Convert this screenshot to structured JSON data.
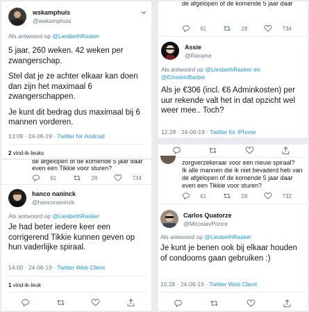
{
  "panel1": {
    "name": "wskamphuis",
    "handle": "@wskamphuis",
    "reply_prefix": "Als antwoord op",
    "reply_to": "@LiesbethRasker",
    "para1": "5 jaar, 260 weken. 42 weken per zwangerschap.",
    "para2": "Stel dat je ze achter elkaar kan doen dan zijn het maximaal 6 zwangerschappen.",
    "para3": "Je kunt dit bedrag dus maximaal bij 6 mannen vorderen.",
    "time": "13:09 · 24-06-19 ·",
    "client": "Twitter for Android",
    "likes_count": "2",
    "likes_label": "vind-ik-leuks"
  },
  "panel2": {
    "quote_fragment": "de afgelopen of de komende 5 jaar daar",
    "stats": {
      "replies": "61",
      "retweets": "28",
      "likes": "734"
    },
    "name": "Assie",
    "handle": "@Rarame",
    "reply_prefix": "Als antwoord op",
    "reply_to": "@LiesbethRasker en @EinsteinBarbie",
    "text": "Als je €306 (incl. €6 Adminkosten) per uur rekende valt het in dat opzicht wel weer mee.. Toch?",
    "time": "12:28 · 24-06-19 ·",
    "client": "Twitter for iPhone"
  },
  "panel3": {
    "quote_fragment_1": "de afgelopen of de komende 5 jaar daar",
    "quote_fragment_2": "even een Tikkie voor sturen?",
    "stats": {
      "replies": "61",
      "retweets": "28",
      "likes": "734"
    },
    "name": "hanco naninck",
    "handle": "@hanconaninck",
    "reply_prefix": "Als antwoord op",
    "reply_to": "@LiesbethRasker",
    "text": "Je had beter iedere keer een corrigerend Tikkie kunnen geven op hun vaderlijke spiraal.",
    "time": "14:00 · 24-06-19 ·",
    "client": "Twitter Web Client",
    "likes_count": "1",
    "likes_label": "vind-ik-leuk"
  },
  "panel4": {
    "quote_line_1": "zorgverzekeraar voor een nieuw spiraal?",
    "quote_line_2": "Ik alle mannen die ik niet bevaderd heb van",
    "quote_line_3": "de afgelopen of de komende 5 jaar daar",
    "quote_line_4": "even een Tikkie voor sturen?",
    "stats": {
      "replies": "61",
      "retweets": "28",
      "likes": "732"
    },
    "name": "Carlos Quatorze",
    "handle": "@MiroslavPrince",
    "reply_prefix": "Als antwoord op",
    "reply_to": "@LiesbethRasker",
    "text": "Je kunt je benen ook bij elkaar houden of condooms gaan gebruiken :)",
    "time": "15:28 · 24-06-19 ·",
    "client": "Twitter Web Client"
  },
  "colors": {
    "link": "#1b95e0",
    "muted": "#657786",
    "heart": "#e0245e"
  }
}
